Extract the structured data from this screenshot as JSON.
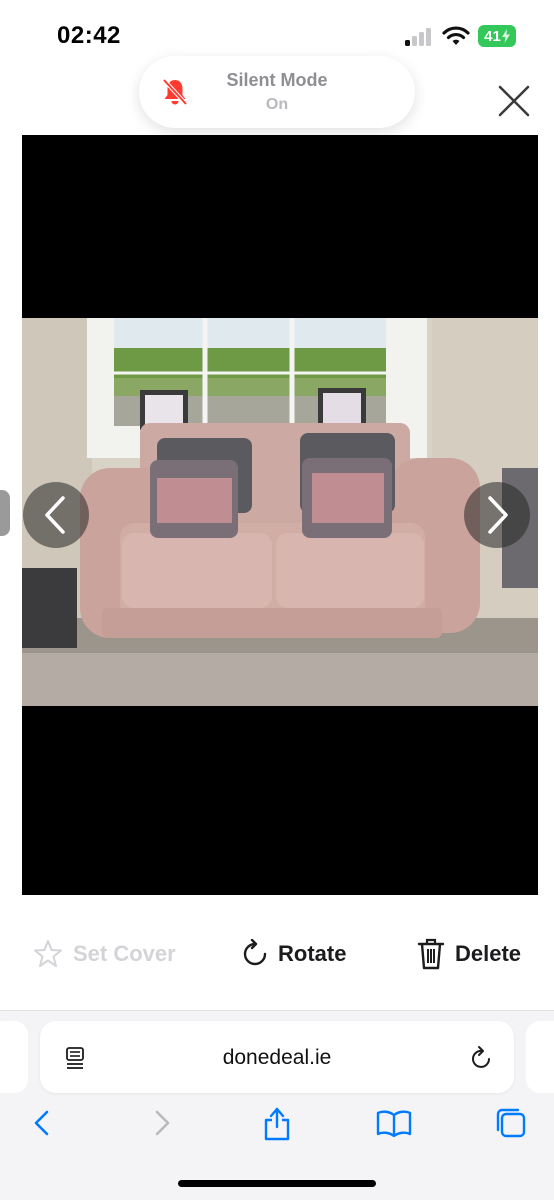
{
  "status_bar": {
    "time": "02:42",
    "battery": "41",
    "battery_color": "#34c759"
  },
  "notification": {
    "title": "Silent Mode",
    "state": "On",
    "icon": "bell-slash-icon",
    "icon_color": "#ff3b30"
  },
  "viewer": {
    "close_icon": "close-icon",
    "prev_icon": "chevron-left-icon",
    "next_icon": "chevron-right-icon"
  },
  "actions": {
    "set_cover": "Set Cover",
    "rotate": "Rotate",
    "delete": "Delete",
    "disabled_color": "#d4d4d8"
  },
  "browser": {
    "url": "donedeal.ie",
    "accent": "#007aff",
    "toolbar": [
      "back-icon",
      "forward-icon",
      "share-icon",
      "bookmarks-icon",
      "tabs-icon"
    ]
  }
}
